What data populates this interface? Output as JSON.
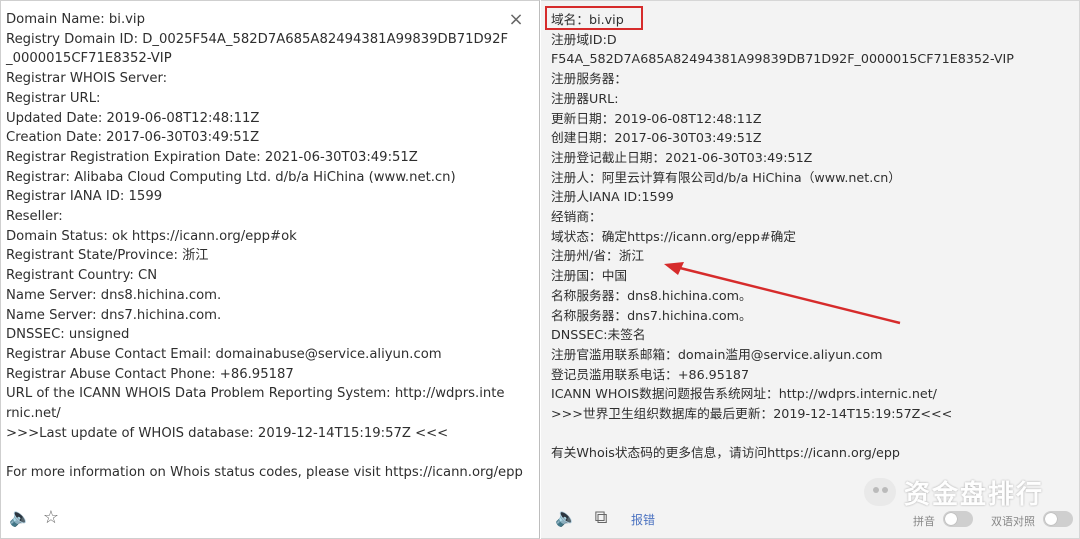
{
  "left_panel": {
    "close_glyph": "×",
    "lines": [
      "Domain Name: bi.vip",
      "Registry Domain ID: D_0025F54A_582D7A685A82494381A99839DB71D92F_0000015CF71E8352-VIP",
      "Registrar WHOIS Server:",
      "Registrar URL:",
      "Updated Date: 2019-06-08T12:48:11Z",
      "Creation Date: 2017-06-30T03:49:51Z",
      "Registrar Registration Expiration Date: 2021-06-30T03:49:51Z",
      "Registrar: Alibaba Cloud Computing Ltd. d/b/a HiChina (www.net.cn)",
      "Registrar IANA ID: 1599",
      "Reseller:",
      "Domain Status: ok https://icann.org/epp#ok",
      "Registrant State/Province: 浙江",
      "Registrant Country: CN",
      "Name Server: dns8.hichina.com.",
      "Name Server: dns7.hichina.com.",
      "DNSSEC: unsigned",
      "Registrar Abuse Contact Email: domainabuse@service.aliyun.com",
      "Registrar Abuse Contact Phone: +86.95187",
      "URL of the ICANN WHOIS Data Problem Reporting System: http://wdprs.internic.net/",
      ">>>Last update of WHOIS database: 2019-12-14T15:19:57Z <<<",
      "",
      "For more information on Whois status codes, please visit https://icann.org/epp"
    ]
  },
  "right_panel": {
    "lines": [
      "域名：bi.vip",
      "注册域ID:D",
      "F54A_582D7A685A82494381A99839DB71D92F_0000015CF71E8352-VIP",
      "注册服务器：",
      "注册器URL:",
      "更新日期：2019-06-08T12:48:11Z",
      "创建日期：2017-06-30T03:49:51Z",
      "注册登记截止日期：2021-06-30T03:49:51Z",
      "注册人：阿里云计算有限公司d/b/a HiChina（www.net.cn）",
      "注册人IANA ID:1599",
      "经销商：",
      "域状态：确定https://icann.org/epp#确定",
      "注册州/省：浙江",
      "注册国：中国",
      "名称服务器：dns8.hichina.com。",
      "名称服务器：dns7.hichina.com。",
      "DNSSEC:未签名",
      "注册官滥用联系邮箱：domain滥用@service.aliyun.com",
      "登记员滥用联系电话：+86.95187",
      "ICANN WHOIS数据问题报告系统网址：http://wdprs.internic.net/",
      ">>>世界卫生组织数据库的最后更新：2019-12-14T15:19:57Z<<<",
      "",
      "有关Whois状态码的更多信息，请访问https://icann.org/epp"
    ],
    "report_label": "报错",
    "pinyin_label": "拼音",
    "bilingual_label": "双语对照"
  },
  "icons": {
    "left_speaker": "🔈",
    "left_star": "☆",
    "right_speaker": "🔈",
    "right_copy": "⧉"
  },
  "watermark": {
    "text": "资金盘排行"
  },
  "colors": {
    "highlight": "#d62b2b",
    "arrow": "#d62b2b",
    "link": "#4b72c0"
  }
}
